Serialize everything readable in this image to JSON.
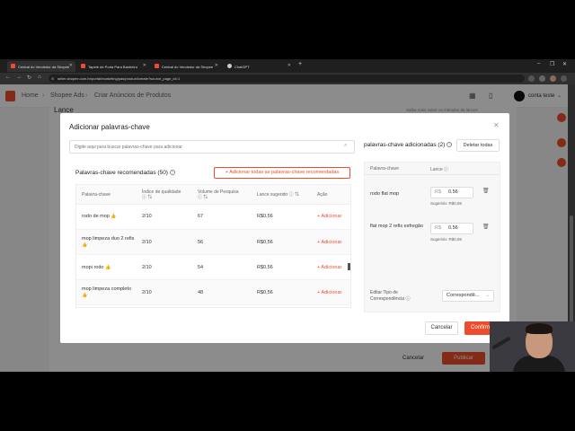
{
  "browser": {
    "tabs": [
      {
        "label": "Central do Vendedor da Shopee",
        "icon": "shopee-icon"
      },
      {
        "label": "Tapete de Porta Para Banheiro",
        "icon": "shopee-icon"
      },
      {
        "label": "Central do Vendedor da Shopee",
        "icon": "shopee-icon"
      },
      {
        "label": "ChatGPT",
        "icon": "chatgpt-icon"
      }
    ],
    "url": "seller.shopee.com.br/portal/marketing/pas/product/create?source_page_id=1"
  },
  "header": {
    "breadcrumb": [
      "Home",
      "Shopee Ads",
      "Criar Anúncios de Produtos"
    ],
    "account_name": "conta teste"
  },
  "page": {
    "section_title": "Lance",
    "hint": "Saiba mais sobre os métodos de lances",
    "cancel_label": "Cancelar",
    "publish_label": "Publicar"
  },
  "modal": {
    "title": "Adicionar palavras-chave",
    "search_placeholder": "Digite aqui para buscar palavras-chave para adicionar",
    "recommended_title": "Palavras-chave recomendadas (50)",
    "add_all_label": "+ Adicionar todas as palavras-chave recomendadas",
    "columns": [
      "Palavra-chave",
      "Índice de qualidade",
      "Volume de Pesquisa",
      "Lance sugerido",
      "Ação"
    ],
    "rows": [
      {
        "keyword": "rodo de mop",
        "quality": "2/10",
        "volume": "67",
        "bid": "R$0,56",
        "action": "+ Adicionar"
      },
      {
        "keyword": "mop limpeza duo 2 refis",
        "quality": "2/10",
        "volume": "56",
        "bid": "R$0,56",
        "action": "+ Adicionar"
      },
      {
        "keyword": "mopi rodo",
        "quality": "2/10",
        "volume": "54",
        "bid": "R$0,56",
        "action": "+ Adicionar"
      },
      {
        "keyword": "mop limpeza completo",
        "quality": "2/10",
        "volume": "48",
        "bid": "R$0,56",
        "action": "+ Adicionar"
      }
    ],
    "selected_title": "palavras-chave adicionadas (2)",
    "delete_all_label": "Deletar todas",
    "selected_columns": [
      "Palavra-chave",
      "Lance"
    ],
    "selected": [
      {
        "keyword": "rodo flat mop",
        "currency": "R$",
        "bid": "0.56",
        "suggested": "Sugerido: R$0,56"
      },
      {
        "keyword": "flat mop 2 refis esfregão",
        "currency": "R$",
        "bid": "0.56",
        "suggested": "Sugerido: R$0,56"
      }
    ],
    "match_type_label": "Editar Tipo de Correspondência",
    "match_type_value": "Correspondê...",
    "cancel_label": "Cancelar",
    "confirm_label": "Confirmar"
  },
  "colors": {
    "accent": "#ee4d2d",
    "overlay": "rgba(0,0,0,0.45)"
  }
}
